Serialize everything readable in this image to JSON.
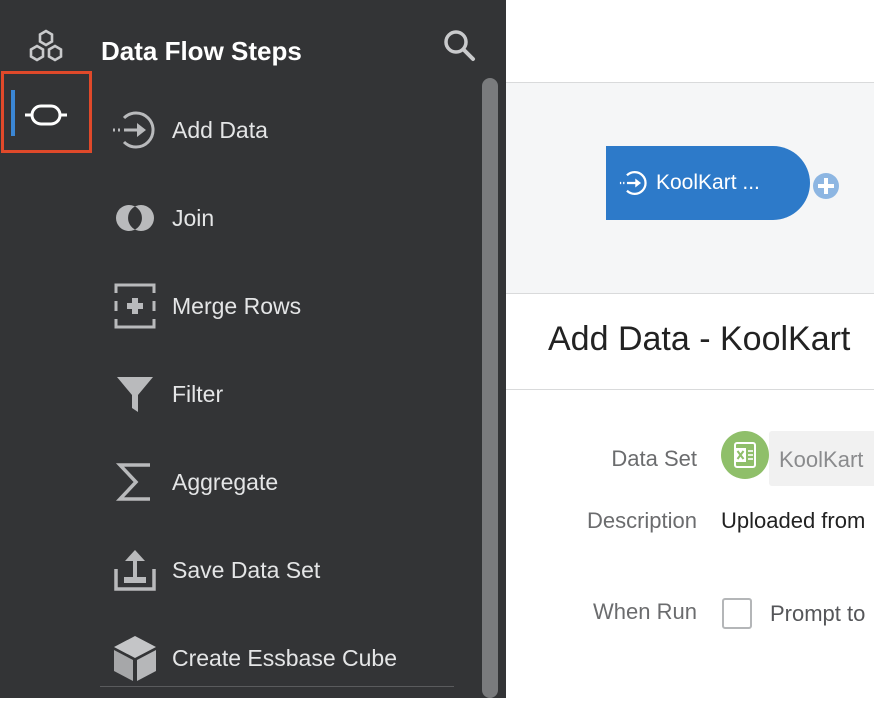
{
  "sidebar": {
    "title": "Data Flow Steps",
    "steps": [
      {
        "label": "Add Data",
        "icon": "add-data-icon"
      },
      {
        "label": "Join",
        "icon": "join-icon"
      },
      {
        "label": "Merge Rows",
        "icon": "merge-rows-icon"
      },
      {
        "label": "Filter",
        "icon": "filter-icon"
      },
      {
        "label": "Aggregate",
        "icon": "aggregate-icon"
      },
      {
        "label": "Save Data Set",
        "icon": "save-data-set-icon"
      },
      {
        "label": "Create Essbase Cube",
        "icon": "cube-icon"
      }
    ]
  },
  "canvas": {
    "node_label": "KoolKart ..."
  },
  "detail": {
    "title": "Add Data - KoolKart",
    "data_set_label": "Data Set",
    "data_set_value": "KoolKart",
    "description_label": "Description",
    "description_value": "Uploaded from",
    "when_run_label": "When Run",
    "prompt_label": "Prompt to"
  },
  "colors": {
    "panel_bg": "#333436",
    "accent": "#2d7ac9",
    "highlight": "#e0492a",
    "excel": "#8fbf6a"
  }
}
